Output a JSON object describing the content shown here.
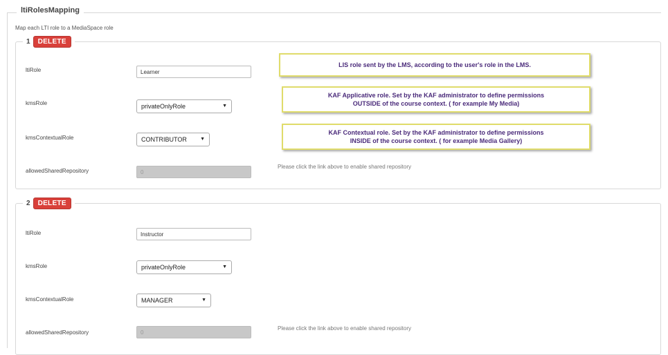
{
  "fieldset": {
    "title": "ltiRolesMapping",
    "description": "Map each LTI role to a MediaSpace role"
  },
  "labels": {
    "ltiRole": "ltiRole",
    "kmsRole": "kmsRole",
    "kmsContextualRole": "kmsContextualRole",
    "allowedSharedRepository": "allowedSharedRepository"
  },
  "delete_label": "DELETE",
  "hint_text": "Please click the link above to enable shared repository",
  "mappings": [
    {
      "index": "1",
      "ltiRole": "Learner",
      "kmsRole": "privateOnlyRole",
      "kmsContextualRole": "CONTRIBUTOR",
      "allowedSharedRepository": "0"
    },
    {
      "index": "2",
      "ltiRole": "Instructor",
      "kmsRole": "privateOnlyRole",
      "kmsContextualRole": "MANAGER",
      "allowedSharedRepository": "0"
    }
  ],
  "annotations": {
    "lis_role": "LIS role sent by the LMS, according to the user's role in the LMS.",
    "kaf_app_line1": "KAF Applicative role. Set by the KAF administrator to define permissions",
    "kaf_app_line2": "OUTSIDE of the course context. ( for example My Media)",
    "kaf_ctx_line1": "KAF Contextual role. Set by the KAF administrator to define permissions",
    "kaf_ctx_line2": "INSIDE of the course context. ( for example Media Gallery)"
  },
  "colors": {
    "delete_button": "#d9403a",
    "annotation_border": "#e0dc6a",
    "annotation_text": "#4a2a7a"
  }
}
